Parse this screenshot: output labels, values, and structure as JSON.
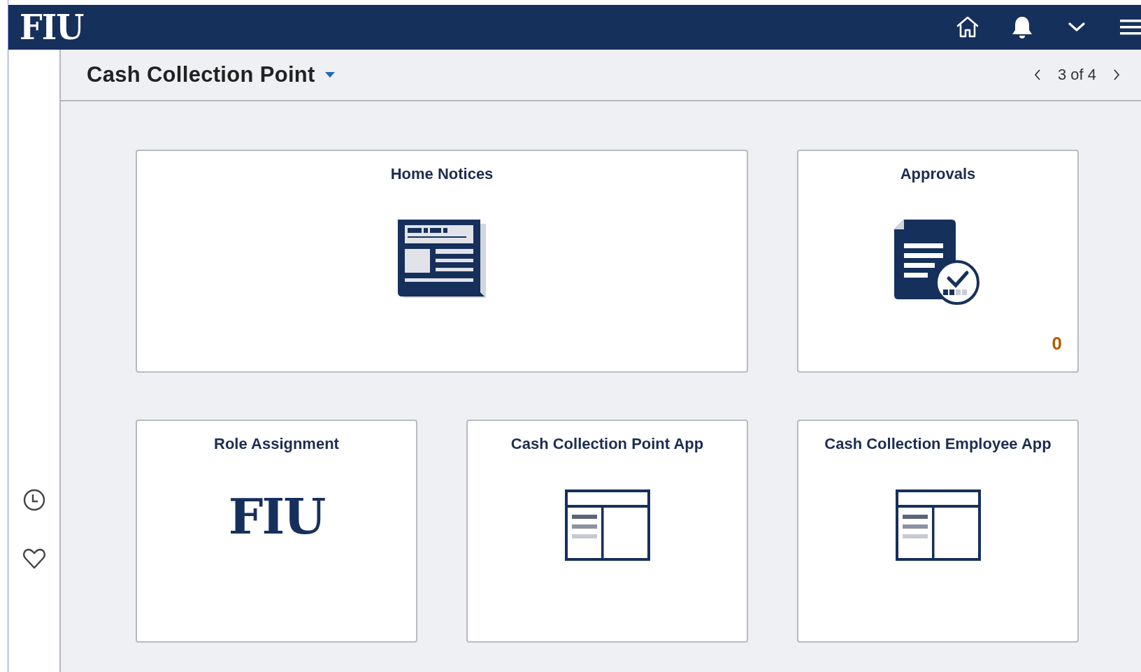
{
  "header": {
    "logo": "FIU",
    "icons": [
      {
        "kind": "home"
      },
      {
        "kind": "bell"
      },
      {
        "kind": "caret"
      },
      {
        "kind": "menu"
      }
    ]
  },
  "sidebar": {
    "items": [
      {
        "kind": "recent"
      },
      {
        "kind": "favorites"
      }
    ]
  },
  "title_bar": {
    "title": "Cash Collection Point",
    "pager": "3 of 4"
  },
  "tiles": [
    {
      "title": "Home Notices",
      "kind": "news",
      "wide": true
    },
    {
      "title": "Approvals",
      "kind": "approvals",
      "badge": "0"
    },
    {
      "title": "Role Assignment",
      "kind": "logo",
      "logo_text": "FIU"
    },
    {
      "title": "Cash Collection Point App",
      "kind": "app"
    },
    {
      "title": "Cash Collection Employee App",
      "kind": "app"
    }
  ]
}
